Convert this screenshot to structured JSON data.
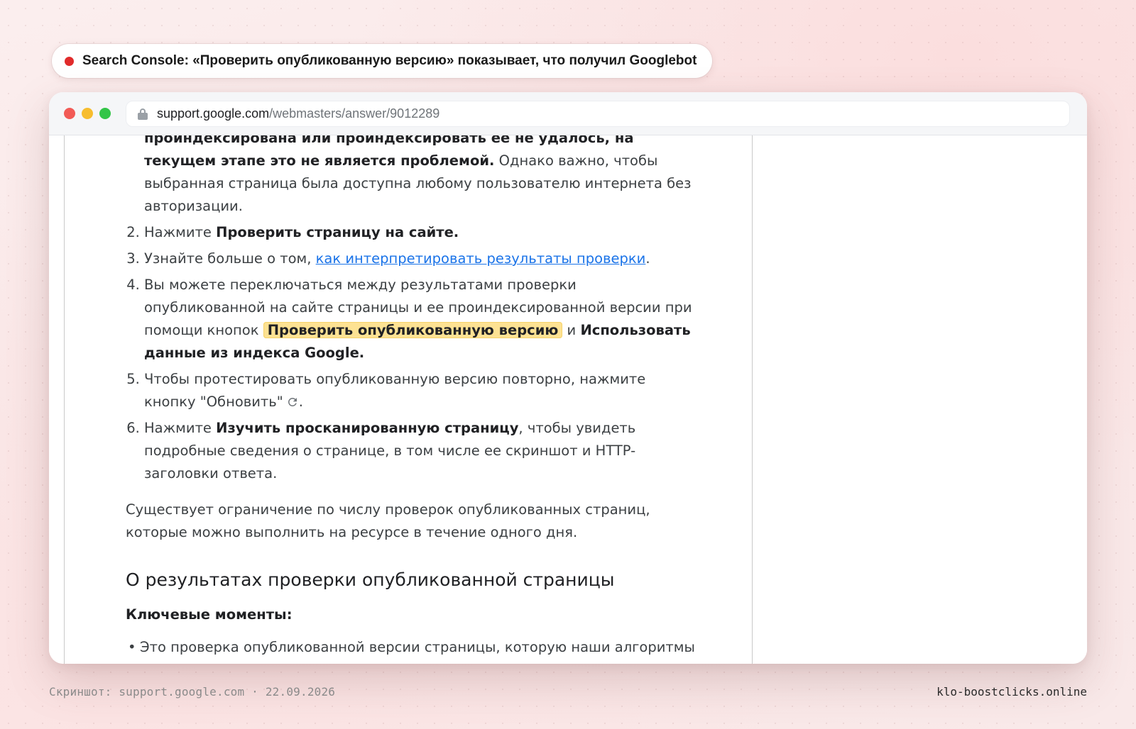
{
  "caption": {
    "text": "Search Console: «Проверить опубликованную версию» показывает, что получил Googlebot"
  },
  "browser": {
    "url_host": "support.google.com",
    "url_path": "/webmasters/answer/9012289"
  },
  "article": {
    "item1_cont_bold": "проиндексирована или проиндексировать ее не удалось, на текущем этапе это не является проблемой.",
    "item1_cont_rest": " Однако важно, чтобы выбранная страница была доступна любому пользователю интернета без авторизации.",
    "item2_prefix": "Нажмите ",
    "item2_bold": "Проверить страницу на сайте.",
    "item3_prefix": "Узнайте больше о том, ",
    "item3_link": "как интерпретировать результаты проверки",
    "item3_suffix": ".",
    "item4_text": "Вы можете переключаться между результатами проверки опубликованной на сайте страницы и ее проиндексированной версии при помощи кнопок ",
    "item4_button1": "Проверить опубликованную версию",
    "item4_and": " и ",
    "item4_button2": "Использовать данные из индекса Google.",
    "item5_text": "Чтобы протестировать опубликованную версию повторно, нажмите кнопку \"Обновить\"",
    "item5_suffix": ".",
    "item6_prefix": "Нажмите ",
    "item6_bold": "Изучить просканированную страницу",
    "item6_rest": ", чтобы увидеть подробные сведения о странице, в том числе ее скриншот и HTTP-заголовки ответа.",
    "limit_para": "Существует ограничение по числу проверок опубликованных страниц, которые можно выполнить на ресурсе в течение одного дня.",
    "section_heading": "О результатах проверки опубликованной страницы",
    "key_points_title": "Ключевые моменты:",
    "bullet1": "Это проверка опубликованной версии страницы, которую наши алгоритмы"
  },
  "footer": {
    "left": "Скриншот: support.google.com · 22.09.2026",
    "right": "klo-boostclicks.online"
  },
  "colors": {
    "highlight": "#fde293",
    "link": "#1a73e8",
    "record_dot": "#e12b2b"
  },
  "icons": {
    "refresh": "refresh-icon",
    "lock": "lock-icon"
  }
}
